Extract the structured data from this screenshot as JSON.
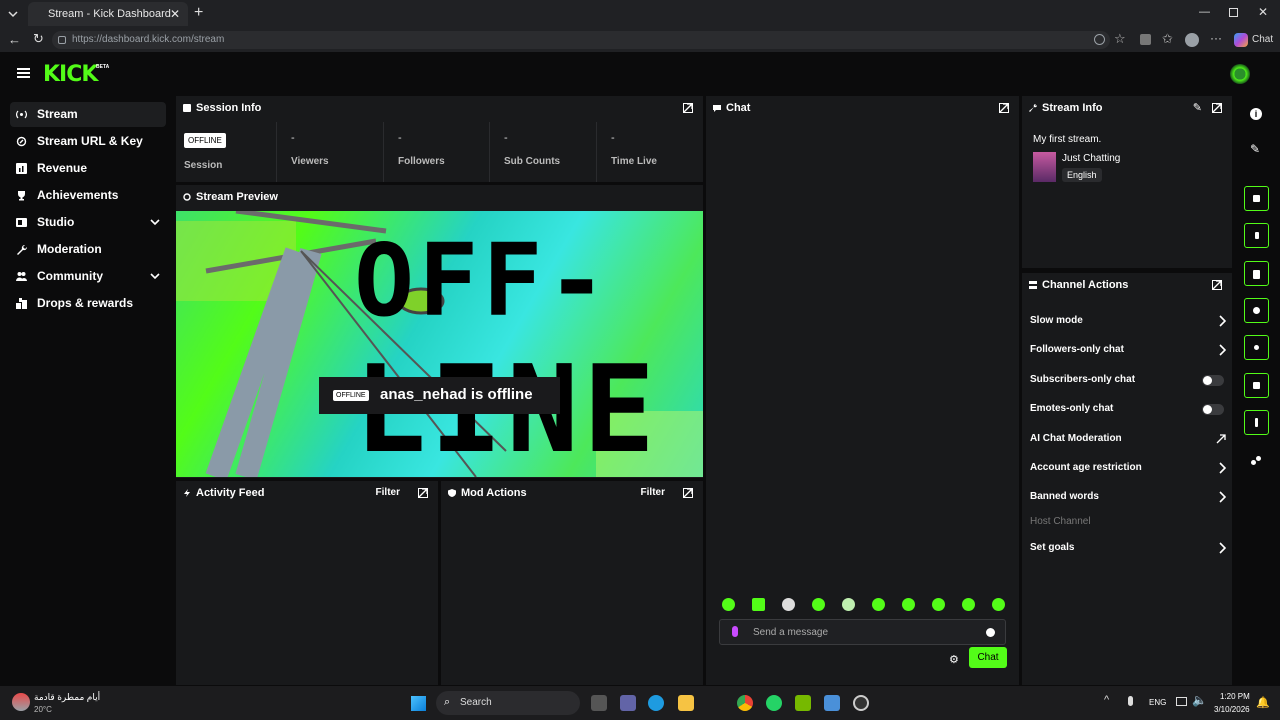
{
  "browser": {
    "tab_title": "Stream - Kick Dashboard",
    "url": "https://dashboard.kick.com/stream",
    "chat_label": "Chat"
  },
  "brand": {
    "logo": "KICK",
    "beta": "BETA",
    "accent": "#53fc18"
  },
  "sidebar": {
    "items": [
      {
        "label": "Stream",
        "icon": "broadcast-icon"
      },
      {
        "label": "Stream URL & Key",
        "icon": "link-icon"
      },
      {
        "label": "Revenue",
        "icon": "chart-icon"
      },
      {
        "label": "Achievements",
        "icon": "trophy-icon"
      },
      {
        "label": "Studio",
        "icon": "studio-icon"
      },
      {
        "label": "Moderation",
        "icon": "wrench-icon"
      },
      {
        "label": "Community",
        "icon": "community-icon"
      },
      {
        "label": "Drops & rewards",
        "icon": "gift-icon"
      }
    ]
  },
  "session": {
    "title": "Session Info",
    "badge": "OFFLINE",
    "stats": [
      {
        "value": "",
        "label": "Session"
      },
      {
        "value": "-",
        "label": "Viewers"
      },
      {
        "value": "-",
        "label": "Followers"
      },
      {
        "value": "-",
        "label": "Sub Counts"
      },
      {
        "value": "-",
        "label": "Time Live"
      }
    ]
  },
  "preview": {
    "title": "Stream Preview",
    "badge": "OFFLINE",
    "offline_text": "anas_nehad is offline",
    "big_text_1": "OFF-",
    "big_text_2": "LINE"
  },
  "activity": {
    "title": "Activity Feed",
    "filter": "Filter"
  },
  "mod": {
    "title": "Mod Actions",
    "filter": "Filter"
  },
  "chat": {
    "title": "Chat",
    "placeholder": "Send a message",
    "send_label": "Chat"
  },
  "stream_info": {
    "title": "Stream Info",
    "stream_title": "My first stream.",
    "category": "Just Chatting",
    "language": "English"
  },
  "channel_actions": {
    "title": "Channel Actions",
    "items": [
      {
        "label": "Slow mode",
        "control": "arrow"
      },
      {
        "label": "Followers-only chat",
        "control": "arrow"
      },
      {
        "label": "Subscribers-only chat",
        "control": "toggle"
      },
      {
        "label": "Emotes-only chat",
        "control": "toggle"
      },
      {
        "label": "AI Chat Moderation",
        "control": "external"
      },
      {
        "label": "Account age restriction",
        "control": "arrow"
      },
      {
        "label": "Banned words",
        "control": "arrow"
      },
      {
        "label": "Host Channel",
        "control": "none"
      },
      {
        "label": "Set goals",
        "control": "arrow"
      }
    ]
  },
  "taskbar": {
    "weather_text": "أيام ممطرة قادمة",
    "temperature": "20°C",
    "search": "Search",
    "lang": "ENG",
    "time": "1:20 PM",
    "date": "3/10/2026"
  }
}
